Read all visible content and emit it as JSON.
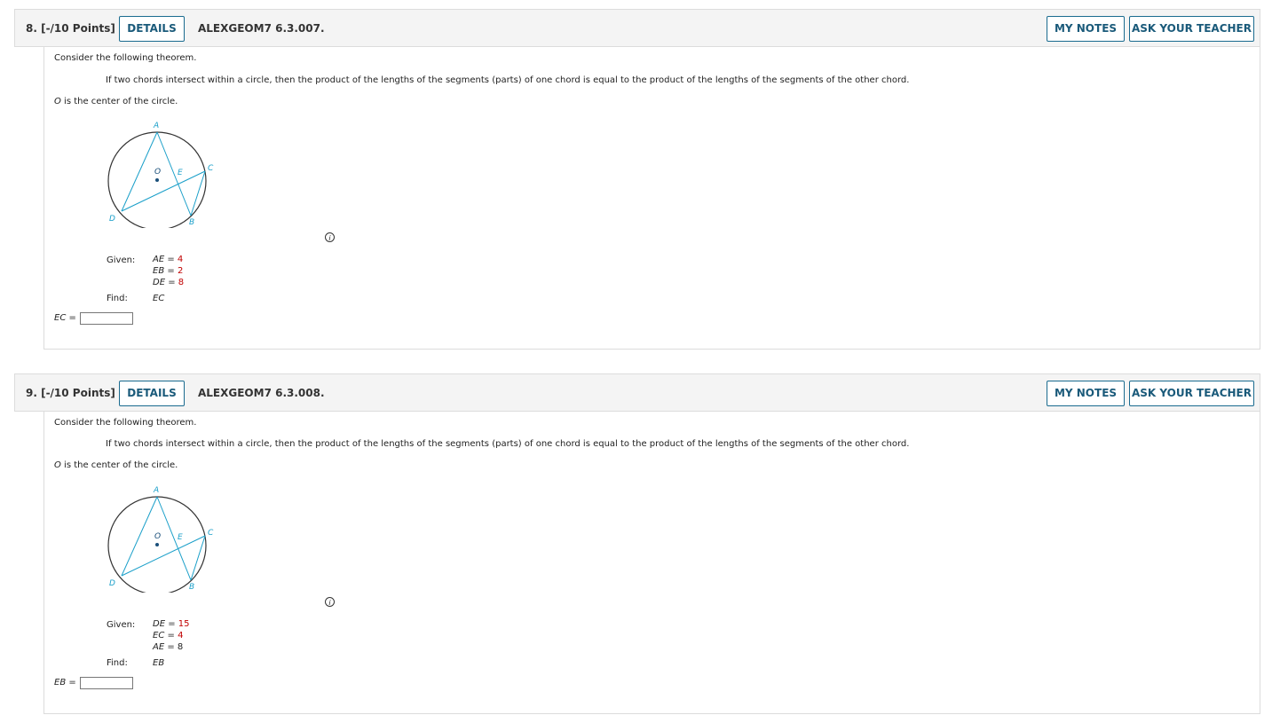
{
  "questions": [
    {
      "number_label": "8. [-/10 Points]",
      "details_label": "DETAILS",
      "code": "ALEXGEOM7 6.3.007.",
      "my_notes_label": "MY NOTES",
      "ask_teacher_label": "ASK YOUR TEACHER",
      "intro": "Consider the following theorem.",
      "theorem": "If two chords intersect within a circle, then the product of the lengths of the segments (parts) of one chord is equal to the product of the lengths of the segments of the other chord.",
      "center_note_var": "O",
      "center_note": " is the center of the circle.",
      "diagram_labels": {
        "A": "A",
        "B": "B",
        "C": "C",
        "D": "D",
        "E": "E",
        "O": "O"
      },
      "given_label": "Given:",
      "given": [
        {
          "var": "AE",
          "eq": " = ",
          "value": "4"
        },
        {
          "var": "EB",
          "eq": " = ",
          "value": "2"
        },
        {
          "var": "DE",
          "eq": " = ",
          "value": "8"
        }
      ],
      "find_label": "Find:",
      "find": "EC",
      "answer_label": "EC",
      "answer_eq": " =",
      "answer_value": ""
    },
    {
      "number_label": "9. [-/10 Points]",
      "details_label": "DETAILS",
      "code": "ALEXGEOM7 6.3.008.",
      "my_notes_label": "MY NOTES",
      "ask_teacher_label": "ASK YOUR TEACHER",
      "intro": "Consider the following theorem.",
      "theorem": "If two chords intersect within a circle, then the product of the lengths of the segments (parts) of one chord is equal to the product of the lengths of the segments of the other chord.",
      "center_note_var": "O",
      "center_note": " is the center of the circle.",
      "diagram_labels": {
        "A": "A",
        "B": "B",
        "C": "C",
        "D": "D",
        "E": "E",
        "O": "O"
      },
      "given_label": "Given:",
      "given": [
        {
          "var": "DE",
          "eq": " = ",
          "value": "15"
        },
        {
          "var": "EC",
          "eq": " = ",
          "value": "4"
        },
        {
          "var": "AE",
          "eq": " = ",
          "value": "8",
          "value_color": "plain"
        }
      ],
      "find_label": "Find:",
      "find": "EB",
      "answer_label": "EB",
      "answer_eq": " =",
      "answer_value": ""
    }
  ],
  "info_icon_glyph": "i",
  "colors": {
    "diagram_line": "#1a9fc9",
    "given_value": "#c00000",
    "button_border": "#1a6b8f"
  }
}
